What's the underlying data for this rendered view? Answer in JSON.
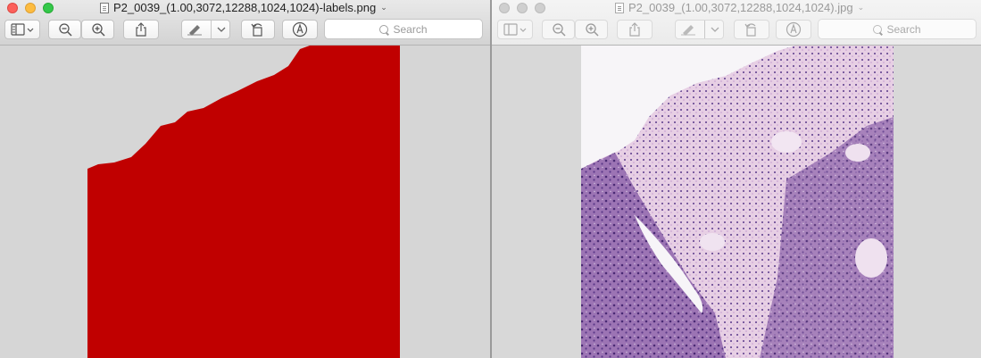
{
  "left_window": {
    "title": "P2_0039_(1.00,3072,12288,1024,1024)-labels.png",
    "title_caret": "⌄",
    "search_placeholder": "Search",
    "toolbar": [
      "sidebar-toggle",
      "zoom-out",
      "zoom-in",
      "share",
      "markup-pen",
      "markup-dropdown",
      "rotate",
      "annotate"
    ],
    "label_color": "#c00000"
  },
  "right_window": {
    "title": "P2_0039_(1.00,3072,12288,1024,1024).jpg",
    "title_caret": "⌄",
    "search_placeholder": "Search",
    "tissue_color": "#8d5fa6"
  },
  "traffic_lights": {
    "close": "#fc605b",
    "minimize": "#fdbc40",
    "zoom": "#34c84a",
    "inactive": "#cfcfcf"
  },
  "icons": [
    "document-icon",
    "sidebar-icon",
    "zoom-out-icon",
    "zoom-in-icon",
    "share-icon",
    "pen-icon",
    "chevron-down-icon",
    "rotate-icon",
    "markup-icon",
    "search-icon"
  ]
}
